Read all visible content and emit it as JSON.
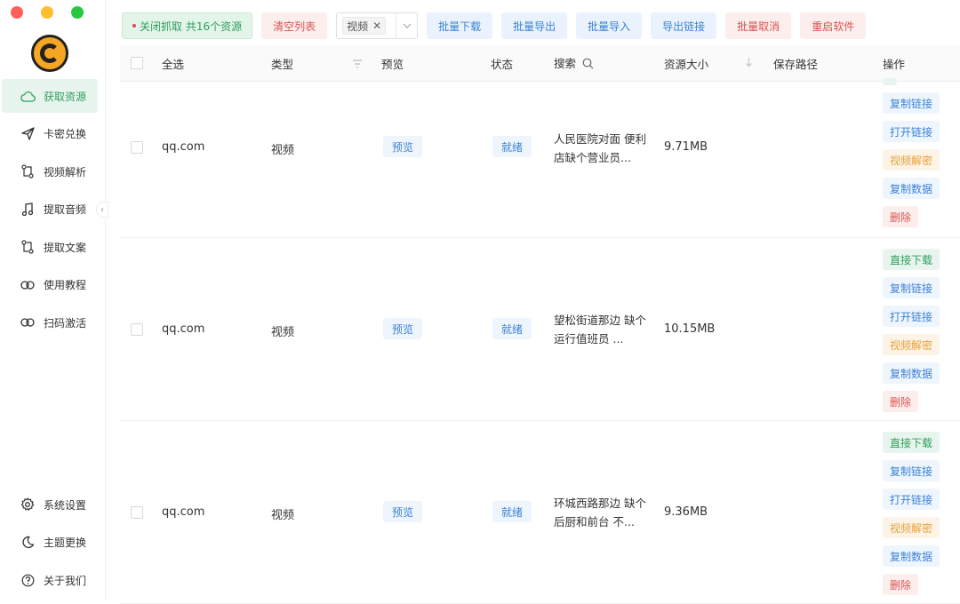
{
  "window_controls": {
    "close_color": "#ff5f57",
    "minimize_color": "#febc2e",
    "maximize_color": "#28c840"
  },
  "sidebar": {
    "items": [
      {
        "label": "获取资源",
        "icon": "cloud-icon",
        "active": true
      },
      {
        "label": "卡密兑换",
        "icon": "send-icon",
        "active": false
      },
      {
        "label": "视频解析",
        "icon": "swap-icon",
        "active": false
      },
      {
        "label": "提取音频",
        "icon": "music-icon",
        "active": false
      },
      {
        "label": "提取文案",
        "icon": "swap-icon",
        "active": false
      },
      {
        "label": "使用教程",
        "icon": "link-icon",
        "active": false
      },
      {
        "label": "扫码激活",
        "icon": "link-icon",
        "active": false
      }
    ],
    "bottom_items": [
      {
        "label": "系统设置",
        "icon": "gear-icon"
      },
      {
        "label": "主题更换",
        "icon": "moon-icon"
      },
      {
        "label": "关于我们",
        "icon": "help-icon"
      }
    ]
  },
  "toolbar": {
    "status_label": "关闭抓取 共16个资源",
    "clear_label": "清空列表",
    "filter_tag": "视频",
    "batch_download": "批量下载",
    "batch_export": "批量导出",
    "batch_import": "批量导入",
    "export_links": "导出链接",
    "batch_cancel": "批量取消",
    "restart": "重启软件"
  },
  "table": {
    "headers": {
      "select_all": "全选",
      "type": "类型",
      "preview": "预览",
      "status": "状态",
      "search": "搜索",
      "size": "资源大小",
      "save_path": "保存路径",
      "actions": "操作"
    },
    "rows": [
      {
        "domain": "qq.com",
        "type": "视频",
        "preview": "预览",
        "status": "就绪",
        "desc": "人民医院对面 便利店缺个营业员...",
        "size": "9.71MB",
        "actions": [
          "复制链接",
          "打开链接",
          "视频解密",
          "复制数据",
          "删除"
        ]
      },
      {
        "domain": "qq.com",
        "type": "视频",
        "preview": "预览",
        "status": "就绪",
        "desc": "望松街道那边 缺个运行值班员 ...",
        "size": "10.15MB",
        "actions": [
          "直接下载",
          "复制链接",
          "打开链接",
          "视频解密",
          "复制数据",
          "删除"
        ]
      },
      {
        "domain": "qq.com",
        "type": "视频",
        "preview": "预览",
        "status": "就绪",
        "desc": "环城西路那边 缺个后厨和前台 不...",
        "size": "9.36MB",
        "actions": [
          "直接下载",
          "复制链接",
          "打开链接",
          "视频解密",
          "复制数据",
          "删除"
        ]
      }
    ]
  }
}
